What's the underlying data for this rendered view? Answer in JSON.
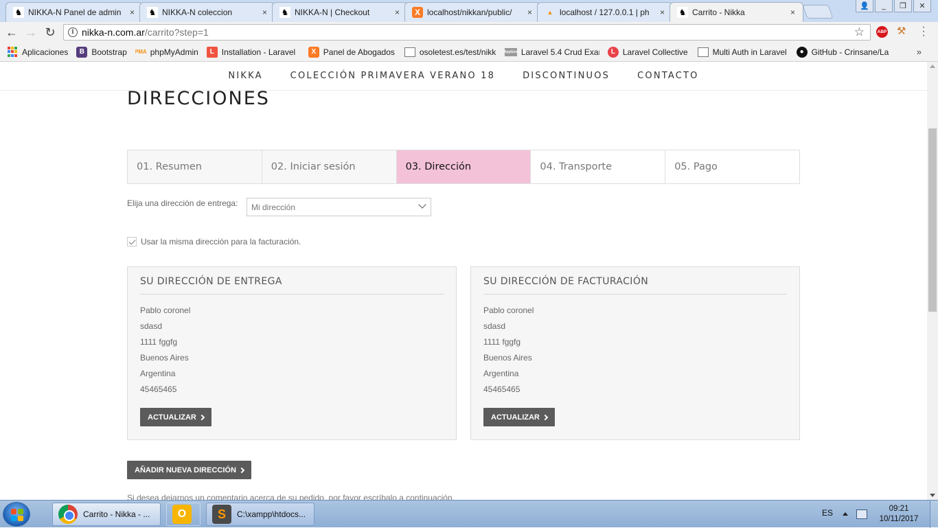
{
  "browser": {
    "tabs": [
      {
        "label": "NIKKA-N Panel de admin",
        "icon": "cat-icon"
      },
      {
        "label": "NIKKA-N coleccion",
        "icon": "cat-icon"
      },
      {
        "label": "NIKKA-N | Checkout",
        "icon": "cat-icon"
      },
      {
        "label": "localhost/nikkan/public/",
        "icon": "xampp-icon"
      },
      {
        "label": "localhost / 127.0.0.1 | ph",
        "icon": "phpmyadmin-icon"
      },
      {
        "label": "Carrito - Nikka",
        "icon": "cat-icon",
        "active": true
      }
    ],
    "close_glyph": "×",
    "url_host": "nikka-n.com.ar",
    "url_path": "/carrito?step=1",
    "abp_label": "ABP",
    "bookmarks": [
      {
        "label": "Aplicaciones",
        "icon": "apps-icon"
      },
      {
        "label": "Bootstrap",
        "icon": "bootstrap-icon",
        "glyph": "B"
      },
      {
        "label": "phpMyAdmin",
        "icon": "phpmyadmin-icon",
        "glyph": "PMA"
      },
      {
        "label": "Installation - Laravel",
        "icon": "laravel-icon",
        "glyph": "L"
      },
      {
        "label": "Panel de Abogados",
        "icon": "xampp-icon",
        "glyph": "X"
      },
      {
        "label": "osoletest.es/test/nikk",
        "icon": "document-icon",
        "glyph": ""
      },
      {
        "label": "Laravel 5.4 Crud Exam",
        "icon": "appgen-icon",
        "glyph": "AppGen"
      },
      {
        "label": "Laravel Collective",
        "icon": "laravel-collective-icon",
        "glyph": "L"
      },
      {
        "label": "Multi Auth in Laravel",
        "icon": "document-icon",
        "glyph": ""
      },
      {
        "label": "GitHub - Crinsane/La",
        "icon": "github-icon",
        "glyph": "●"
      }
    ],
    "more_glyph": "»"
  },
  "site": {
    "nav": [
      "NIKKA",
      "COLECCIÓN PRIMAVERA VERANO 18",
      "DISCONTINUOS",
      "CONTACTO"
    ],
    "page_title": "DIRECCIONES",
    "steps": [
      {
        "label": "01. Resumen"
      },
      {
        "label": "02. Iniciar sesión"
      },
      {
        "label": "03. Dirección",
        "active": true
      },
      {
        "label": "04. Transporte"
      },
      {
        "label": "05. Pago"
      }
    ],
    "active_color": "#f4c2d8",
    "address_select_label": "Elija una dirección de entrega:",
    "address_select_value": "Mi dirección",
    "same_billing_label": "Usar la misma dirección para la facturación.",
    "same_billing_checked": true,
    "delivery": {
      "title": "SU DIRECCIÓN DE ENTREGA",
      "lines": [
        "Pablo coronel",
        "sdasd",
        "1111 fggfg",
        "Buenos Aires",
        "Argentina",
        "45465465"
      ],
      "button": "ACTUALIZAR"
    },
    "billing": {
      "title": "SU DIRECCIÓN DE FACTURACIÓN",
      "lines": [
        "Pablo coronel",
        "sdasd",
        "1111 fggfg",
        "Buenos Aires",
        "Argentina",
        "45465465"
      ],
      "button": "ACTUALIZAR"
    },
    "add_address_button": "AÑADIR NUEVA DIRECCIÓN",
    "comment_hint": "Si desea dejarnos un comentario acerca de su pedido, por favor escríbalo a continuación."
  },
  "taskbar": {
    "tasks": [
      {
        "label": "Carrito - Nikka - ...",
        "icon": "chrome-icon"
      },
      {
        "label": "",
        "icon": "outlook-icon",
        "glyph": "O"
      },
      {
        "label": "C:\\xampp\\htdocs...",
        "icon": "sublime-text-icon",
        "glyph": "S"
      }
    ],
    "language": "ES",
    "time": "09:21",
    "date": "10/11/2017"
  }
}
